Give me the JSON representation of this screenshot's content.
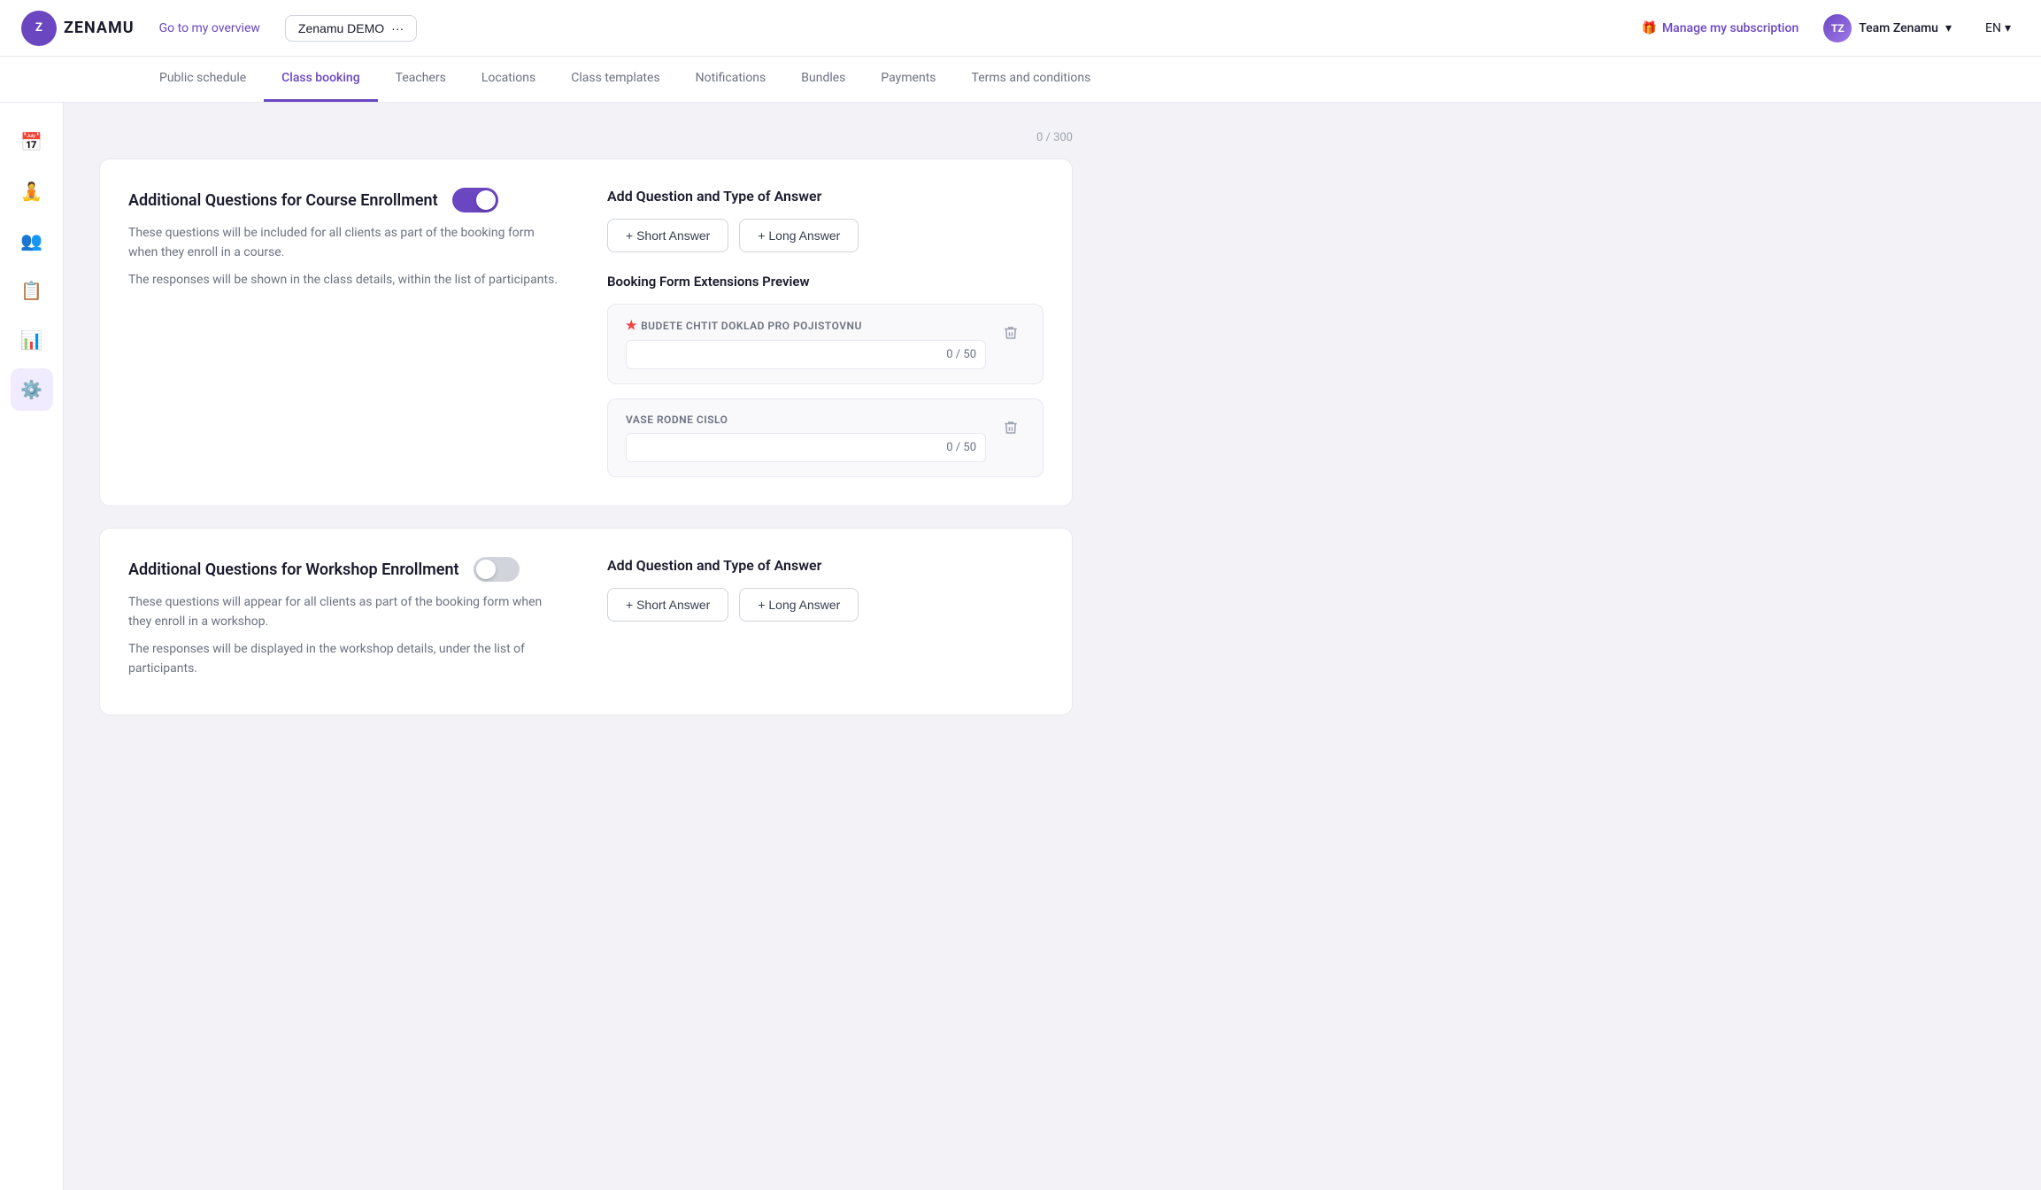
{
  "topbar": {
    "logo_text": "ZENAMU",
    "overview_link": "Go to my overview",
    "demo_btn": "Zenamu DEMO",
    "more_icon": "···",
    "subscription_link": "Manage my subscription",
    "team_name": "Team Zenamu",
    "lang": "EN"
  },
  "nav": {
    "tabs": [
      {
        "id": "public-schedule",
        "label": "Public schedule",
        "active": false
      },
      {
        "id": "class-booking",
        "label": "Class booking",
        "active": true
      },
      {
        "id": "teachers",
        "label": "Teachers",
        "active": false
      },
      {
        "id": "locations",
        "label": "Locations",
        "active": false
      },
      {
        "id": "class-templates",
        "label": "Class templates",
        "active": false
      },
      {
        "id": "notifications",
        "label": "Notifications",
        "active": false
      },
      {
        "id": "bundles",
        "label": "Bundles",
        "active": false
      },
      {
        "id": "payments",
        "label": "Payments",
        "active": false
      },
      {
        "id": "terms-conditions",
        "label": "Terms and conditions",
        "active": false
      }
    ]
  },
  "sidebar": {
    "items": [
      {
        "id": "calendar",
        "icon": "📅"
      },
      {
        "id": "clients",
        "icon": "🧘"
      },
      {
        "id": "team",
        "icon": "👥"
      },
      {
        "id": "reports",
        "icon": "📋"
      },
      {
        "id": "analytics",
        "icon": "📊"
      },
      {
        "id": "settings",
        "icon": "⚙️",
        "active": true
      }
    ]
  },
  "counter": "0 / 300",
  "course_section": {
    "title": "Additional Questions for Course Enrollment",
    "toggle_on": true,
    "desc1": "These questions will be included for all clients as part of the booking form when they enroll in a course.",
    "desc2": "The responses will be shown in the class details, within the list of participants.",
    "add_question_title": "Add Question and Type of Answer",
    "short_answer_btn": "+ Short Answer",
    "long_answer_btn": "+ Long Answer",
    "preview_title": "Booking Form Extensions Preview",
    "questions": [
      {
        "label": "BUDETE CHTIT DOKLAD PRO POJISTOVNU",
        "required": true,
        "counter": "0 / 50"
      },
      {
        "label": "VASE RODNE CISLO",
        "required": false,
        "counter": "0 / 50"
      }
    ]
  },
  "workshop_section": {
    "title": "Additional Questions for Workshop Enrollment",
    "toggle_on": false,
    "desc1": "These questions will appear for all clients as part of the booking form when they enroll in a workshop.",
    "desc2": "The responses will be displayed in the workshop details, under the list of participants.",
    "add_question_title": "Add Question and Type of Answer",
    "short_answer_btn": "+ Short Answer",
    "long_answer_btn": "+ Long Answer"
  }
}
